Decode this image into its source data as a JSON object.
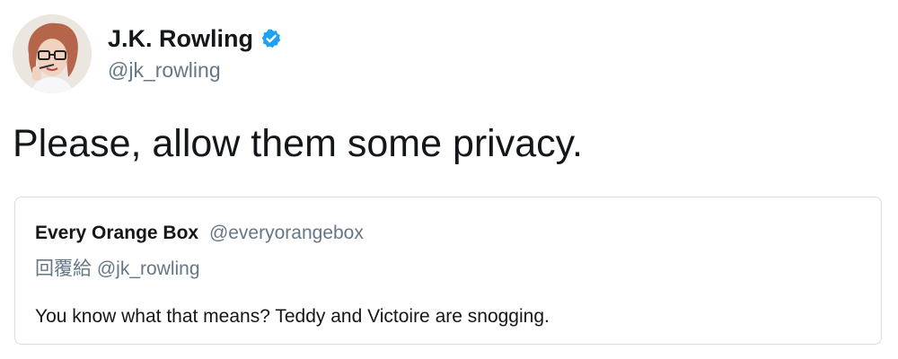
{
  "author": {
    "display_name": "J.K. Rowling",
    "handle": "@jk_rowling",
    "verified": true,
    "avatar_icon": "profile-photo",
    "verified_color": "#1da1f2"
  },
  "tweet": {
    "text": "Please, allow them some privacy."
  },
  "quoted_tweet": {
    "display_name": "Every Orange Box",
    "handle": "@everyorangebox",
    "reply_prefix": "回覆給",
    "reply_to": "@jk_rowling",
    "text": "You know what that means? Teddy and Victoire are snogging."
  },
  "colors": {
    "text_primary": "#14171a",
    "text_secondary": "#657786",
    "border": "#d6dde3"
  }
}
